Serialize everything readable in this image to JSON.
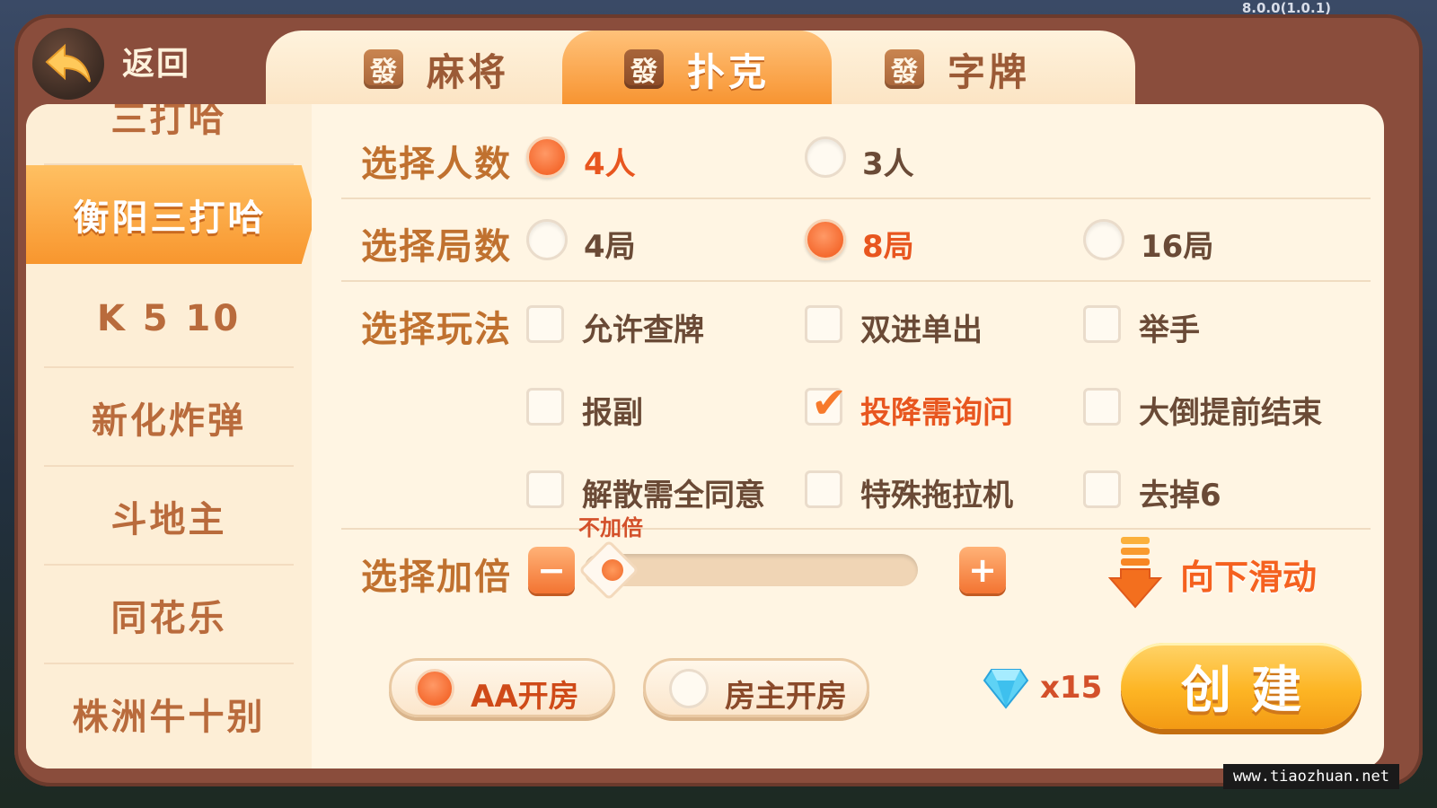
{
  "version": "8.0.0(1.0.1)",
  "header": {
    "back_label": "返回"
  },
  "tabs": [
    {
      "tile": "發",
      "label": "麻将",
      "active": false
    },
    {
      "tile": "發",
      "label": "扑克",
      "active": true
    },
    {
      "tile": "發",
      "label": "字牌",
      "active": false
    }
  ],
  "sidebar": {
    "items": [
      {
        "label": "三打哈",
        "partial": true
      },
      {
        "label": "衡阳三打哈",
        "active": true
      },
      {
        "label": "K 5 10"
      },
      {
        "label": "新化炸弹"
      },
      {
        "label": "斗地主"
      },
      {
        "label": "同花乐"
      },
      {
        "label": "株洲牛十别"
      }
    ]
  },
  "players": {
    "label": "选择人数",
    "options": [
      {
        "label": "4人",
        "selected": true
      },
      {
        "label": "3人",
        "selected": false
      }
    ]
  },
  "rounds": {
    "label": "选择局数",
    "options": [
      {
        "label": "4局",
        "selected": false
      },
      {
        "label": "8局",
        "selected": true
      },
      {
        "label": "16局",
        "selected": false
      }
    ]
  },
  "rules": {
    "label": "选择玩法",
    "options": [
      {
        "label": "允许查牌",
        "checked": false
      },
      {
        "label": "双进单出",
        "checked": false
      },
      {
        "label": "举手",
        "checked": false
      },
      {
        "label": "报副",
        "checked": false
      },
      {
        "label": "投降需询问",
        "checked": true
      },
      {
        "label": "大倒提前结束",
        "checked": false
      },
      {
        "label": "解散需全同意",
        "checked": false
      },
      {
        "label": "特殊拖拉机",
        "checked": false
      },
      {
        "label": "去掉6",
        "checked": false
      }
    ]
  },
  "multiplier": {
    "label": "选择加倍",
    "value_text": "不加倍",
    "minus": "−",
    "plus": "+",
    "level": 0
  },
  "scroll_hint": "向下滑动",
  "room_type": {
    "options": [
      {
        "label": "AA开房",
        "selected": true
      },
      {
        "label": "房主开房",
        "selected": false
      }
    ]
  },
  "cost": {
    "count": "x15",
    "icon": "diamond-icon"
  },
  "create_label": "创建",
  "watermark": "www.tiaozhuan.net",
  "colors": {
    "accent": "#f56a2f",
    "frame": "#8a4d3c",
    "panel": "#fff5e3",
    "label": "#c0712f",
    "create": "#fdb524"
  }
}
